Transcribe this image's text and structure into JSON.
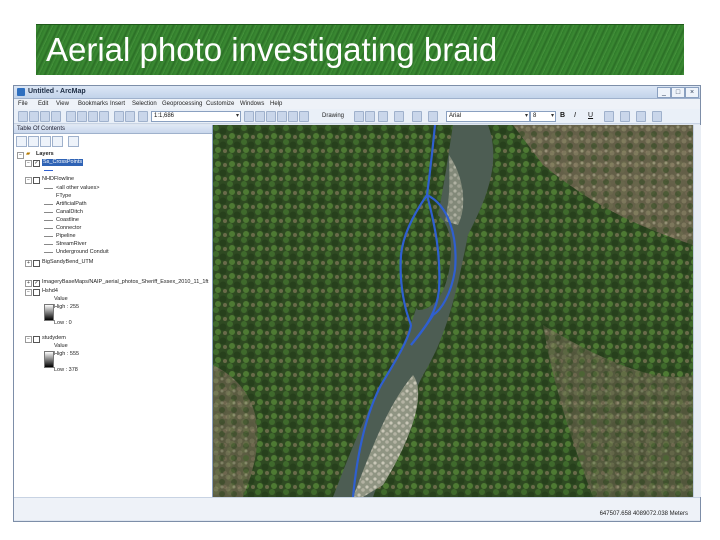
{
  "slide": {
    "title": "Aerial photo investigating braid"
  },
  "window": {
    "title": "Untitled - ArcMap",
    "controls": [
      "_",
      "□",
      "×"
    ]
  },
  "menubar": [
    "File",
    "Edit",
    "View",
    "Bookmarks",
    "Insert",
    "Selection",
    "Geoprocessing",
    "Customize",
    "Windows",
    "Help"
  ],
  "toolbar": {
    "scale": "1:1,686",
    "drawing_label": "Drawing",
    "font": "Arial",
    "font_size": "8",
    "bold": "B",
    "italic": "I",
    "underline": "U"
  },
  "toc": {
    "header": "Table Of Contents",
    "root": "Layers",
    "layers": [
      {
        "name": "Ss_CrossPoints",
        "selected": true,
        "checked": true,
        "expanded": true
      },
      {
        "name": "NHDFlowline",
        "checked": false,
        "expanded": true,
        "legend": [
          "<all other values>",
          "FType",
          "ArtificialPath",
          "CanalDitch",
          "Coastline",
          "Connector",
          "Pipeline",
          "StreamRiver",
          "Underground Conduit"
        ]
      },
      {
        "name": "BigSandyBend_UTM",
        "checked": false,
        "expanded": false
      },
      {
        "name": "ImageryBaseMaps/NAIP_aerial_photos_Sheriff_Essex_2010_11_1ft",
        "checked": true,
        "expanded": false
      },
      {
        "name": "Hshd4",
        "checked": false,
        "expanded": true,
        "legend": [
          "Value",
          "High : 255",
          "Low : 0"
        ]
      },
      {
        "name": "studydem",
        "checked": false,
        "expanded": true,
        "legend": [
          "Value",
          "High : 555",
          "Low : 378"
        ]
      }
    ]
  },
  "status": {
    "coordinates": "647507.658  4089072.038 Meters"
  },
  "colors": {
    "stream_line": "#2f5fd0",
    "selection": "#2f63b5",
    "banner": "#3b8a33"
  }
}
